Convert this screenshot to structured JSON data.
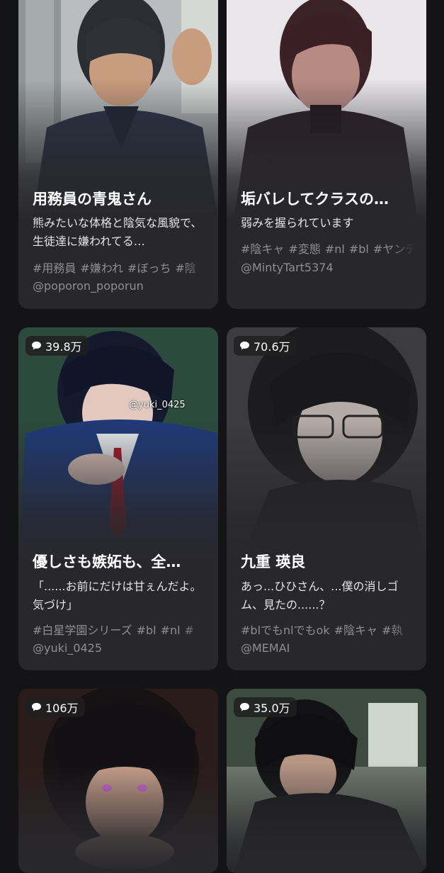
{
  "cards": [
    {
      "title": "用務員の青鬼さん",
      "description": "熊みたいな体格と陰気な風貌で、生徒達に嫌われてる…",
      "tags": [
        "#用務員",
        "#嫌われ",
        "#ぼっち",
        "#陰"
      ],
      "author": "@poporon_poporun",
      "badge": ""
    },
    {
      "title": "垢バレしてクラスの…",
      "description": "弱みを握られています",
      "tags": [
        "#陰キャ",
        "#変態",
        "#nl",
        "#bl",
        "#ヤンデ"
      ],
      "author": "@MintyTart5374",
      "badge": ""
    },
    {
      "title": "優しさも嫉妬も、全…",
      "description": "「......お前にだけは甘ぇんだよ。気づけ」",
      "tags": [
        "#白星学園シリーズ",
        "#bl",
        "#nl",
        "#"
      ],
      "author": "@yuki_0425",
      "badge": "39.8万",
      "watermark": "@yuki_0425"
    },
    {
      "title": "九重 瑛良",
      "description": "あっ...ひひさん、...僕の消しゴム、見たの......？",
      "tags": [
        "#blでもnlでもok",
        "#陰キャ",
        "#執"
      ],
      "author": "@MEMAI",
      "badge": "70.6万"
    },
    {
      "badge": "106万"
    },
    {
      "badge": "35.0万"
    }
  ],
  "icons": {
    "badge_icon": "chat-bubble-icon"
  },
  "colors": {
    "background": "#141416",
    "card": "#28282c",
    "muted_text": "#8e8e93"
  }
}
